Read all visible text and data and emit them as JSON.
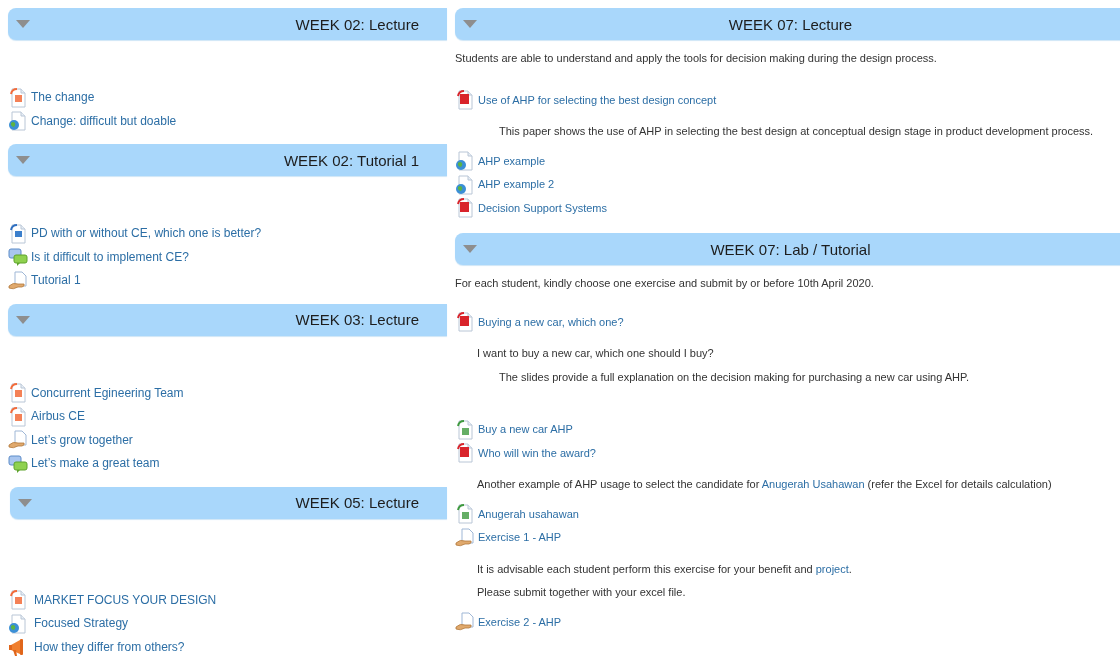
{
  "columns": [
    {
      "sections": [
        {
          "title": "WEEK 02: Lecture",
          "expanded": true,
          "items": [
            {
              "kind": "slides",
              "label": "The change"
            },
            {
              "kind": "webpage",
              "label": "Change: difficult but doable"
            }
          ]
        },
        {
          "title": "WEEK 02: Tutorial 1",
          "expanded": true,
          "items": [
            {
              "kind": "image",
              "label": "PD with or without CE, which one is better?"
            },
            {
              "kind": "forum",
              "label": "Is it difficult to implement CE?"
            },
            {
              "kind": "assignment",
              "label": "Tutorial 1"
            }
          ]
        },
        {
          "title": "WEEK 03: Lecture",
          "expanded": true,
          "items": [
            {
              "kind": "slides",
              "label": "Concurrent Egineering Team"
            },
            {
              "kind": "slides",
              "label": "Airbus CE"
            },
            {
              "kind": "assignment",
              "label": "Let’s grow together"
            },
            {
              "kind": "forum",
              "label": "Let’s make a great team"
            }
          ]
        },
        {
          "title": "WEEK 05: Lecture",
          "expanded": true,
          "items": [
            {
              "kind": "slides",
              "label": "MARKET FOCUS YOUR DESIGN"
            },
            {
              "kind": "webpage",
              "label": "Focused Strategy"
            },
            {
              "kind": "megaphone",
              "label": "How they differ from others?"
            }
          ]
        }
      ]
    },
    {
      "sections": [
        {
          "title": "WEEK 07: Lecture",
          "expanded": true,
          "items": [
            {
              "kind": "summary",
              "segments": [
                "Students are able to understand and apply the tools for decision making during the design process."
              ]
            },
            {
              "kind": "pdf",
              "label": "Use of AHP for selecting the best design concept"
            },
            {
              "kind": "description",
              "segments": [
                "This paper shows the use of AHP in selecting the best design at conceptual design stage in product development process."
              ]
            },
            {
              "kind": "webpage",
              "label": "AHP example"
            },
            {
              "kind": "webpage",
              "label": "AHP example 2"
            },
            {
              "kind": "pdf",
              "label": "Decision Support Systems"
            }
          ]
        },
        {
          "title": "WEEK 07: Lab / Tutorial",
          "expanded": true,
          "items": [
            {
              "kind": "summary",
              "segments": [
                "For each student, kindly choose one exercise and submit by or before 10th April 2020."
              ]
            },
            {
              "kind": "pdf",
              "label": "Buying a new car, which one?"
            },
            {
              "kind": "text",
              "segments": [
                "I want to buy a new car, which one should I buy?"
              ]
            },
            {
              "kind": "description",
              "segments": [
                "The slides provide a full explanation on the decision making for purchasing a new car using AHP."
              ]
            },
            {
              "kind": "spreadsheet",
              "label": "Buy a new car AHP"
            },
            {
              "kind": "pdf",
              "label": "Who will win the award?"
            },
            {
              "kind": "text",
              "segments": [
                "Another example of AHP usage to select the candidate for ",
                {
                  "link": "Anugerah Usahawan"
                },
                " (refer the Excel for details calculation)"
              ]
            },
            {
              "kind": "spreadsheet",
              "label": "Anugerah usahawan"
            },
            {
              "kind": "assignment",
              "label": "Exercise 1 - AHP"
            },
            {
              "kind": "text",
              "segments": [
                "It is advisable each student perform this exercise for your benefit and ",
                {
                  "link": "project"
                },
                "."
              ]
            },
            {
              "kind": "text",
              "segments": [
                "Please submit together with your excel file."
              ]
            },
            {
              "kind": "assignment",
              "label": "Exercise 2 - AHP"
            }
          ]
        }
      ]
    }
  ]
}
